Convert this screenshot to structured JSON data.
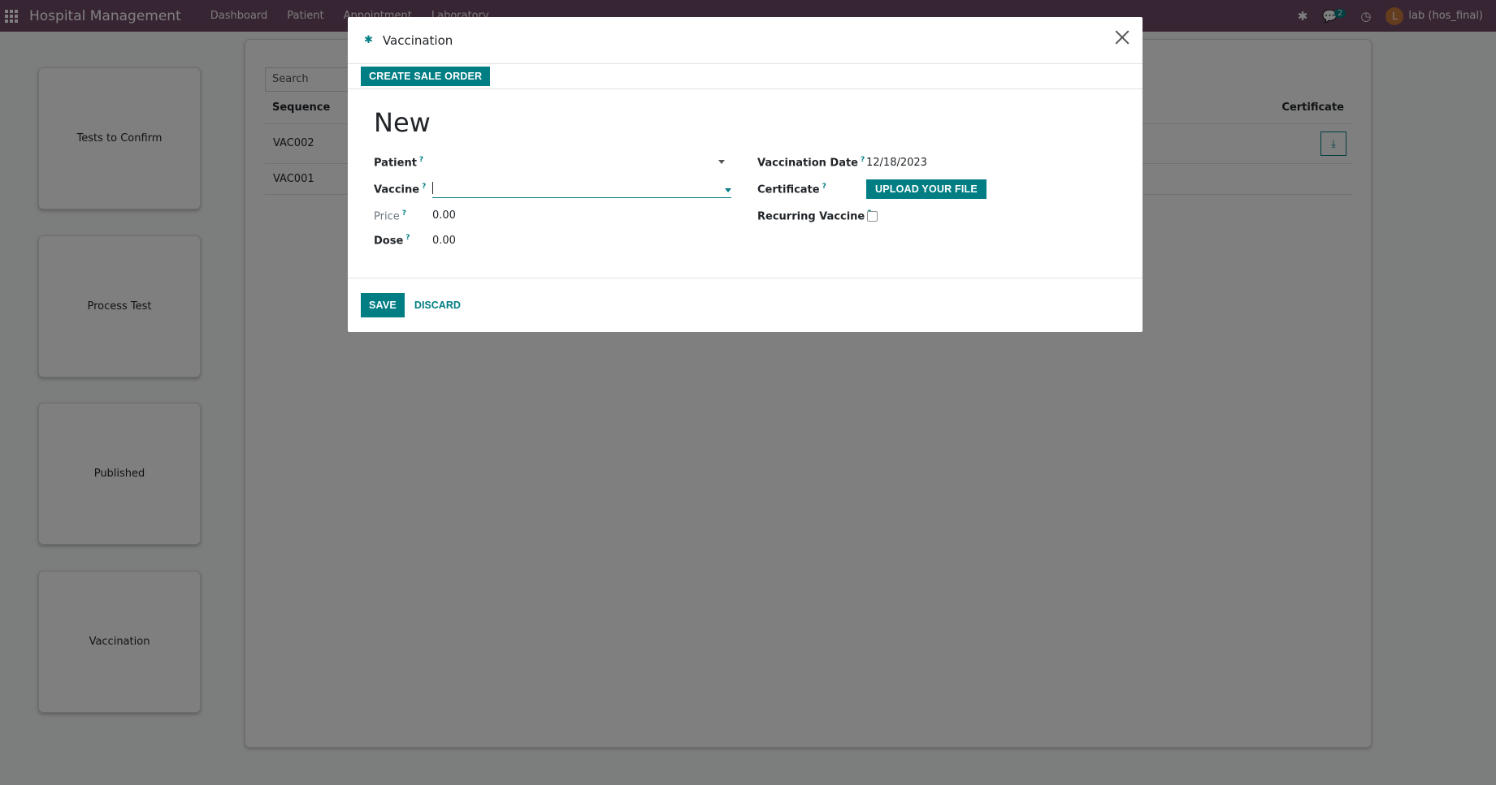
{
  "navbar": {
    "brand": "Hospital Management",
    "menu": [
      "Dashboard",
      "Patient",
      "Appointment",
      "Laboratory"
    ],
    "messages_count": "2",
    "user_initial": "L",
    "user_name": "lab (hos_final)"
  },
  "sidebar": {
    "cards": [
      "Tests to Confirm",
      "Process Test",
      "Published",
      "Vaccination"
    ]
  },
  "list": {
    "search_placeholder": "Search",
    "columns": {
      "sequence": "Sequence",
      "certificate": "Certificate"
    },
    "rows": [
      {
        "sequence": "VAC002"
      },
      {
        "sequence": "VAC001"
      }
    ]
  },
  "dialog": {
    "title": "Vaccination",
    "create_sale_order": "CREATE SALE ORDER",
    "record_name": "New",
    "fields": {
      "patient_label": "Patient",
      "patient_value": "",
      "vaccine_label": "Vaccine",
      "vaccine_value": "",
      "price_label": "Price",
      "price_value": "0.00",
      "dose_label": "Dose",
      "dose_value": "0.00",
      "vaccination_date_label": "Vaccination Date",
      "vaccination_date_value": "12/18/2023",
      "certificate_label": "Certificate",
      "upload_label": "UPLOAD YOUR FILE",
      "recurring_label": "Recurring Vaccine",
      "recurring_checked": false,
      "help_mark": "?"
    },
    "save_label": "SAVE",
    "discard_label": "DISCARD"
  },
  "colors": {
    "navbar": "#714b67",
    "primary": "#017e84"
  },
  "icons": {
    "apps": "apps-grid-icon",
    "bug": "bug-icon",
    "chat": "chat-icon",
    "clock": "clock-icon",
    "download": "download-icon",
    "close": "close-icon"
  }
}
